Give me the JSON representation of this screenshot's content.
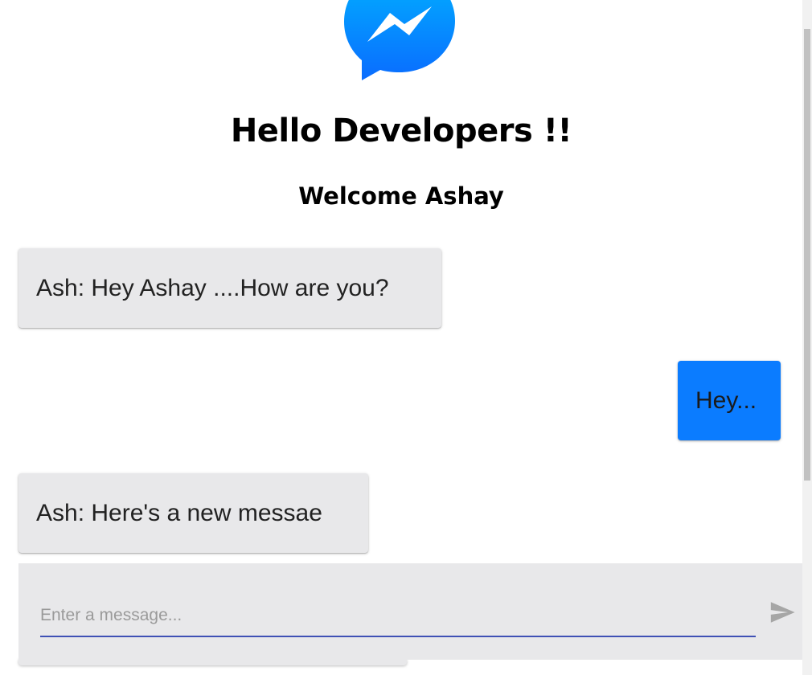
{
  "header": {
    "logo_icon": "messenger-logo-icon",
    "title": "Hello Developers !!",
    "welcome": "Welcome Ashay"
  },
  "messages": [
    {
      "text": "Ash: Hey Ashay ....How are you?",
      "from": "other"
    },
    {
      "text": "Hey...",
      "from": "self"
    },
    {
      "text": "Ash: Here's a new messae",
      "from": "other"
    }
  ],
  "composer": {
    "placeholder": "Enter a message...",
    "value": "",
    "send_icon": "send-icon"
  },
  "colors": {
    "brand_blue": "#0b7cff",
    "bubble_gray": "#e8e8ea",
    "input_underline": "#3f51b5"
  }
}
